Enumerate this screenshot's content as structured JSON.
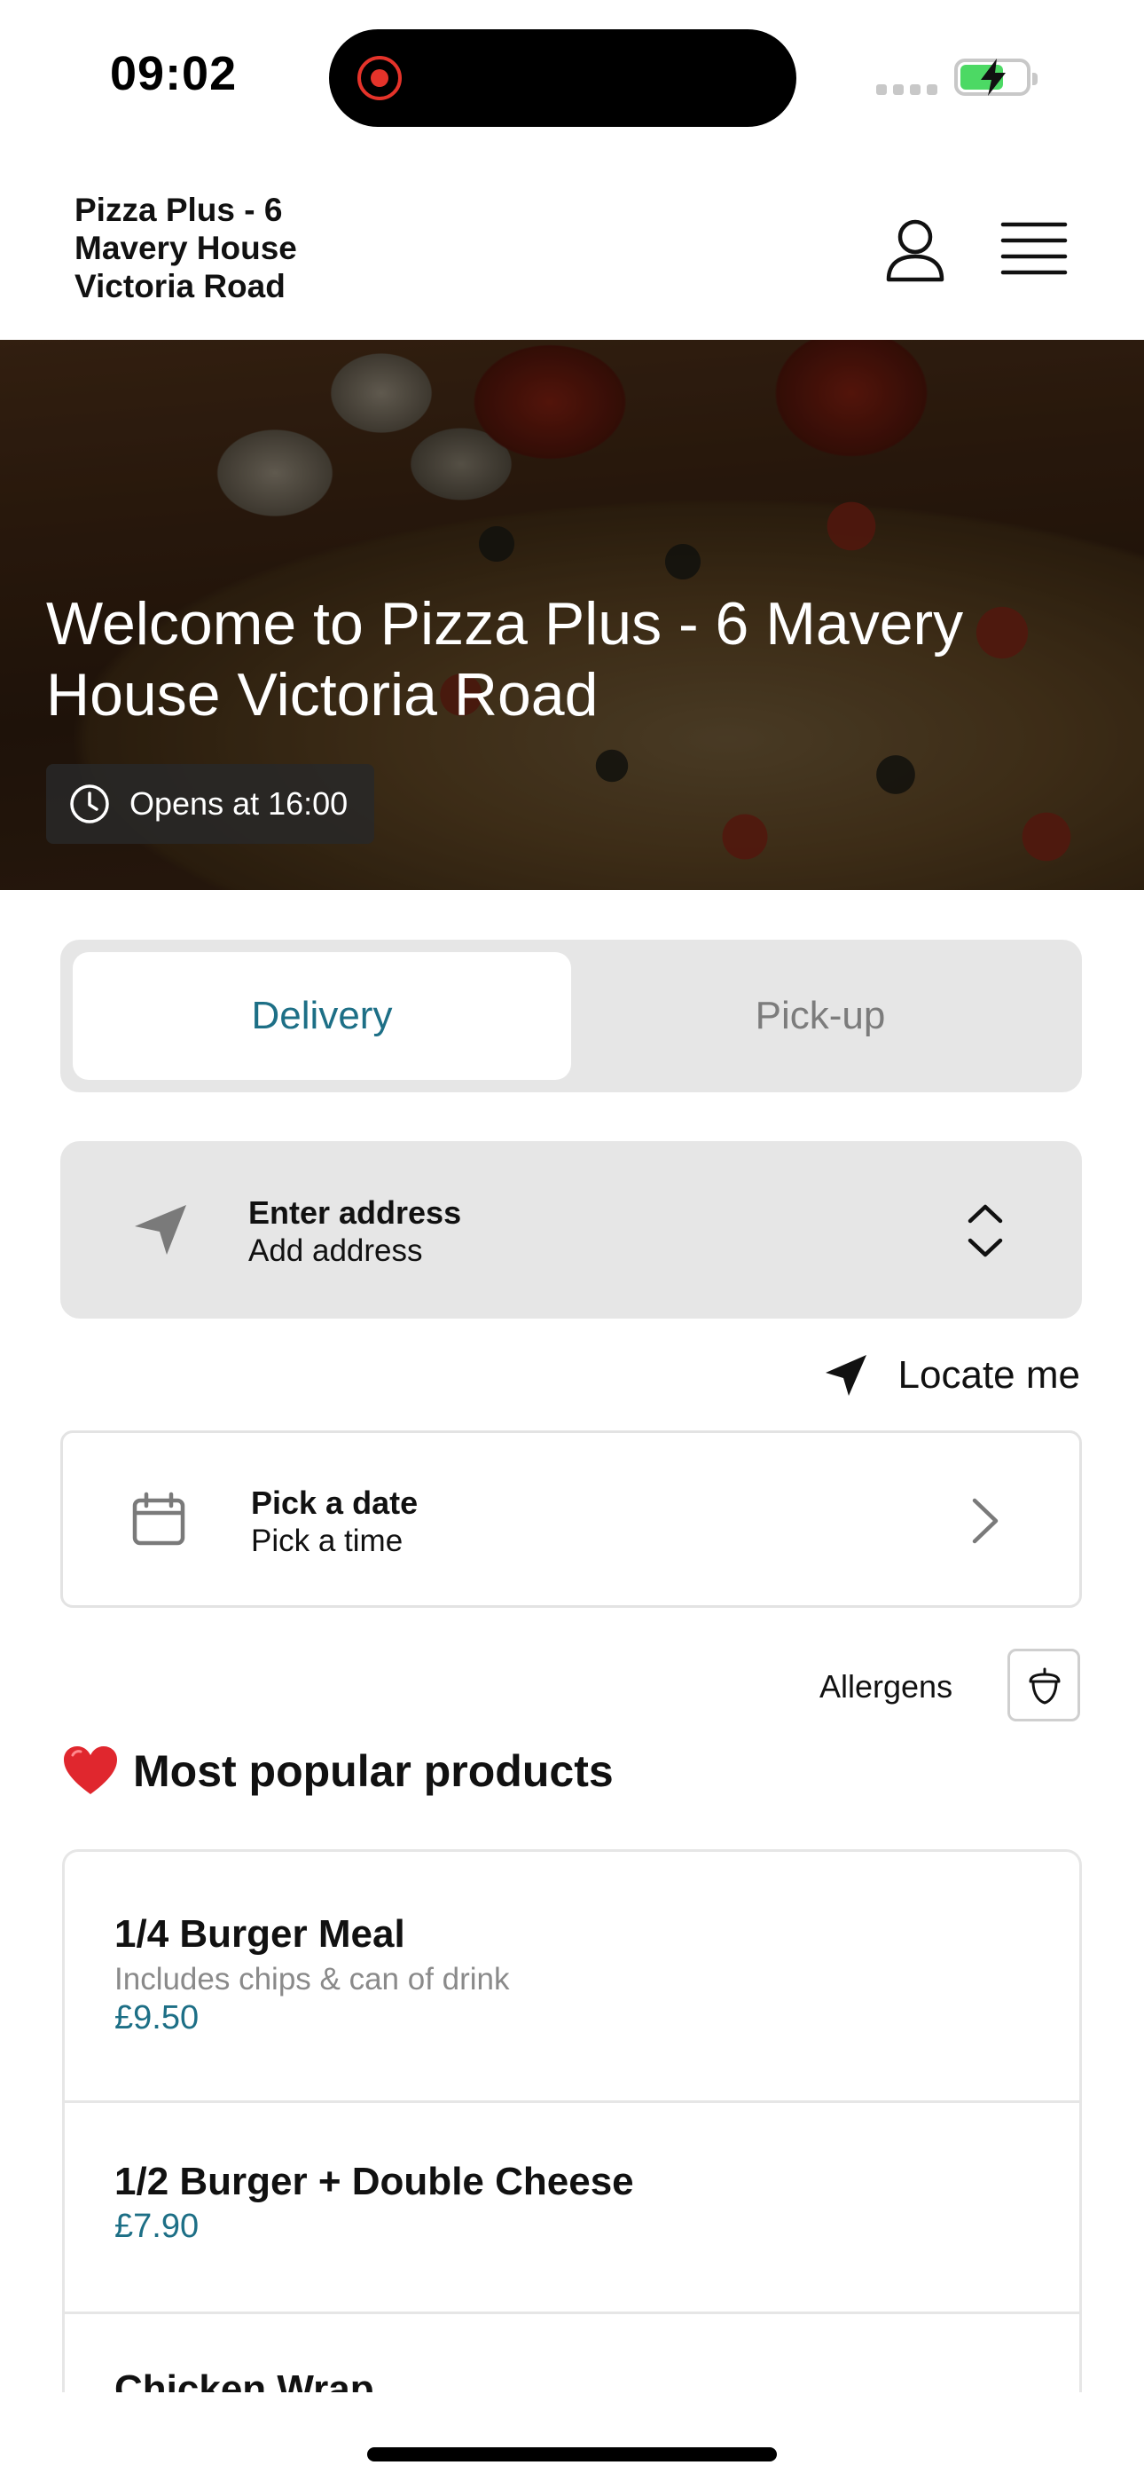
{
  "status_bar": {
    "time": "09:02"
  },
  "header": {
    "store_name": "Pizza Plus - 6\nMavery House\nVictoria Road"
  },
  "hero": {
    "title": "Welcome to Pizza Plus - 6 Mavery House Victoria Road",
    "hours": "Opens at 16:00"
  },
  "order_mode": {
    "tabs": [
      {
        "label": "Delivery",
        "selected": true
      },
      {
        "label": "Pick-up",
        "selected": false
      }
    ],
    "accent_color": "#1d6f86"
  },
  "address": {
    "title": "Enter address",
    "subtitle": "Add address"
  },
  "locate": {
    "label": "Locate me"
  },
  "schedule": {
    "date_label": "Pick a date",
    "time_label": "Pick a time"
  },
  "allergens": {
    "label": "Allergens"
  },
  "popular": {
    "title": "Most popular products",
    "products": [
      {
        "name": "1/4 Burger Meal",
        "description": "Includes chips & can of drink",
        "price": "£9.50"
      },
      {
        "name": "1/2 Burger + Double Cheese",
        "price": "£7.90"
      },
      {
        "name": "Chicken Wrap"
      }
    ]
  },
  "icons": {
    "account": "user-icon",
    "menu": "hamburger-menu-icon",
    "hours": "clock-icon",
    "address": "navigation-arrow-icon",
    "address_toggle": "chevron-up-down-icon",
    "locate": "location-arrow-icon",
    "date": "calendar-icon",
    "date_next": "chevron-right-icon",
    "allergens": "acorn-icon",
    "popular": "heart-icon"
  }
}
